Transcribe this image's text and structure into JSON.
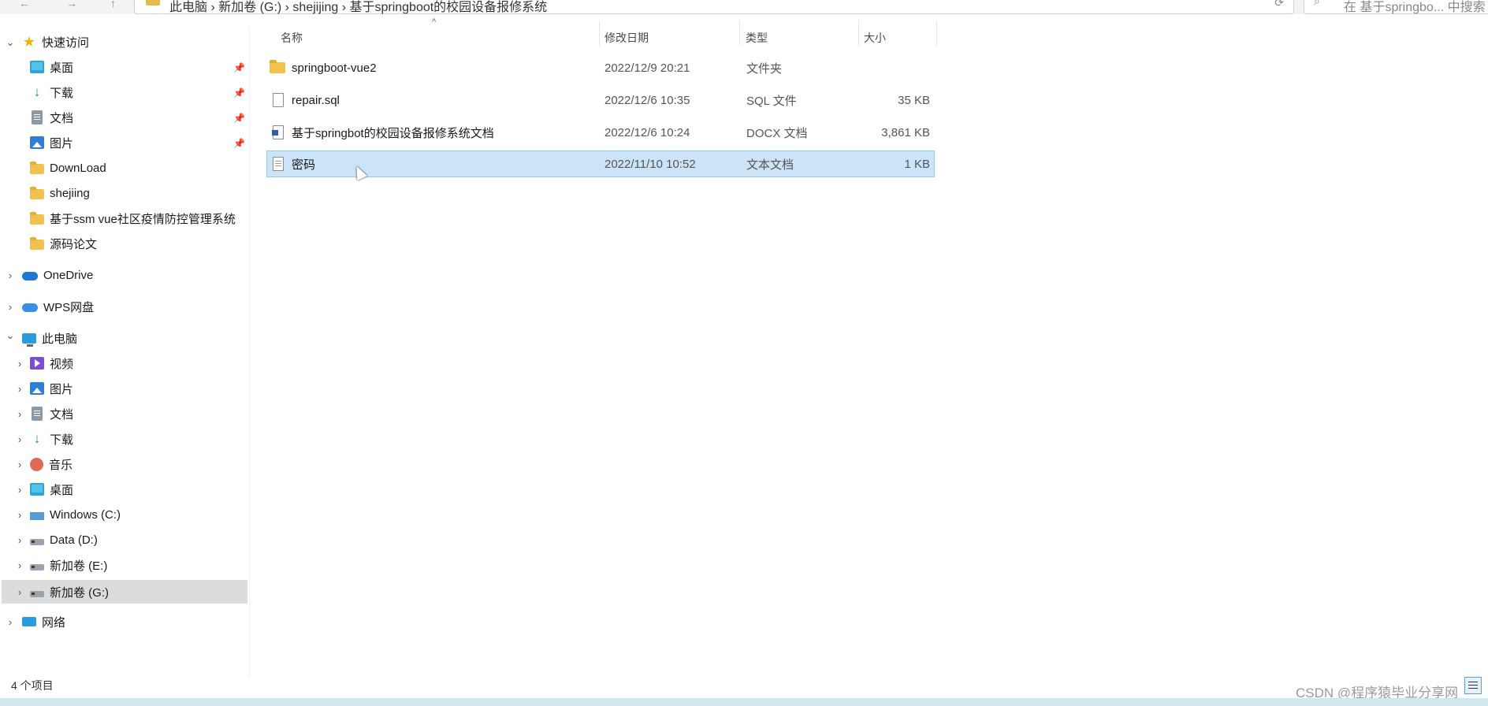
{
  "address_bar": {
    "path": "此电脑 › 新加卷 (G:) › shejijing › 基于springboot的校园设备报修系统"
  },
  "search": {
    "placeholder": "在 基于springbo... 中搜索"
  },
  "sidebar": {
    "quick_access": {
      "label": "快速访问"
    },
    "quick_items": [
      {
        "label": "桌面",
        "icon": "desktop-icon",
        "pinned": true
      },
      {
        "label": "下载",
        "icon": "download-icon",
        "pinned": true
      },
      {
        "label": "文档",
        "icon": "document-icon",
        "pinned": true
      },
      {
        "label": "图片",
        "icon": "pictures-icon",
        "pinned": true
      },
      {
        "label": "DownLoad",
        "icon": "folder-icon"
      },
      {
        "label": "shejiing",
        "icon": "folder-icon"
      },
      {
        "label": "基于ssm vue社区疫情防控管理系统",
        "icon": "folder-icon"
      },
      {
        "label": "源码论文",
        "icon": "folder-icon"
      }
    ],
    "onedrive": {
      "label": "OneDrive"
    },
    "wps": {
      "label": "WPS网盘"
    },
    "this_pc": {
      "label": "此电脑"
    },
    "pc_items": [
      {
        "label": "视频",
        "icon": "video-icon"
      },
      {
        "label": "图片",
        "icon": "pictures-icon"
      },
      {
        "label": "文档",
        "icon": "document-icon"
      },
      {
        "label": "下载",
        "icon": "download-icon"
      },
      {
        "label": "音乐",
        "icon": "music-icon"
      },
      {
        "label": "桌面",
        "icon": "desktop-icon"
      },
      {
        "label": "Windows (C:)",
        "icon": "windows-drive-icon"
      },
      {
        "label": "Data (D:)",
        "icon": "drive-icon"
      },
      {
        "label": "新加卷 (E:)",
        "icon": "drive-icon"
      },
      {
        "label": "新加卷 (G:)",
        "icon": "drive-icon",
        "selected": true
      }
    ],
    "network": {
      "label": "网络"
    }
  },
  "columns": {
    "name": "名称",
    "date": "修改日期",
    "type": "类型",
    "size": "大小"
  },
  "files": [
    {
      "name": "springboot-vue2",
      "date": "2022/12/9 20:21",
      "type": "文件夹",
      "size": "",
      "icon": "folder-icon"
    },
    {
      "name": "repair.sql",
      "date": "2022/12/6 10:35",
      "type": "SQL 文件",
      "size": "35 KB",
      "icon": "file-icon"
    },
    {
      "name": "基于springbot的校园设备报修系统文档",
      "date": "2022/12/6 10:24",
      "type": "DOCX 文档",
      "size": "3,861 KB",
      "icon": "docx-icon"
    },
    {
      "name": "密码",
      "date": "2022/11/10 10:52",
      "type": "文本文档",
      "size": "1 KB",
      "icon": "text-file-icon",
      "selected": true
    }
  ],
  "status": {
    "item_count": "4 个项目"
  },
  "watermark": "CSDN @程序猿毕业分享网",
  "colors": {
    "selection": "#cce4f7",
    "sidebar_selection": "#dcdcdc",
    "folder": "#f2c14e",
    "taskbar": "#cfe7ee"
  }
}
